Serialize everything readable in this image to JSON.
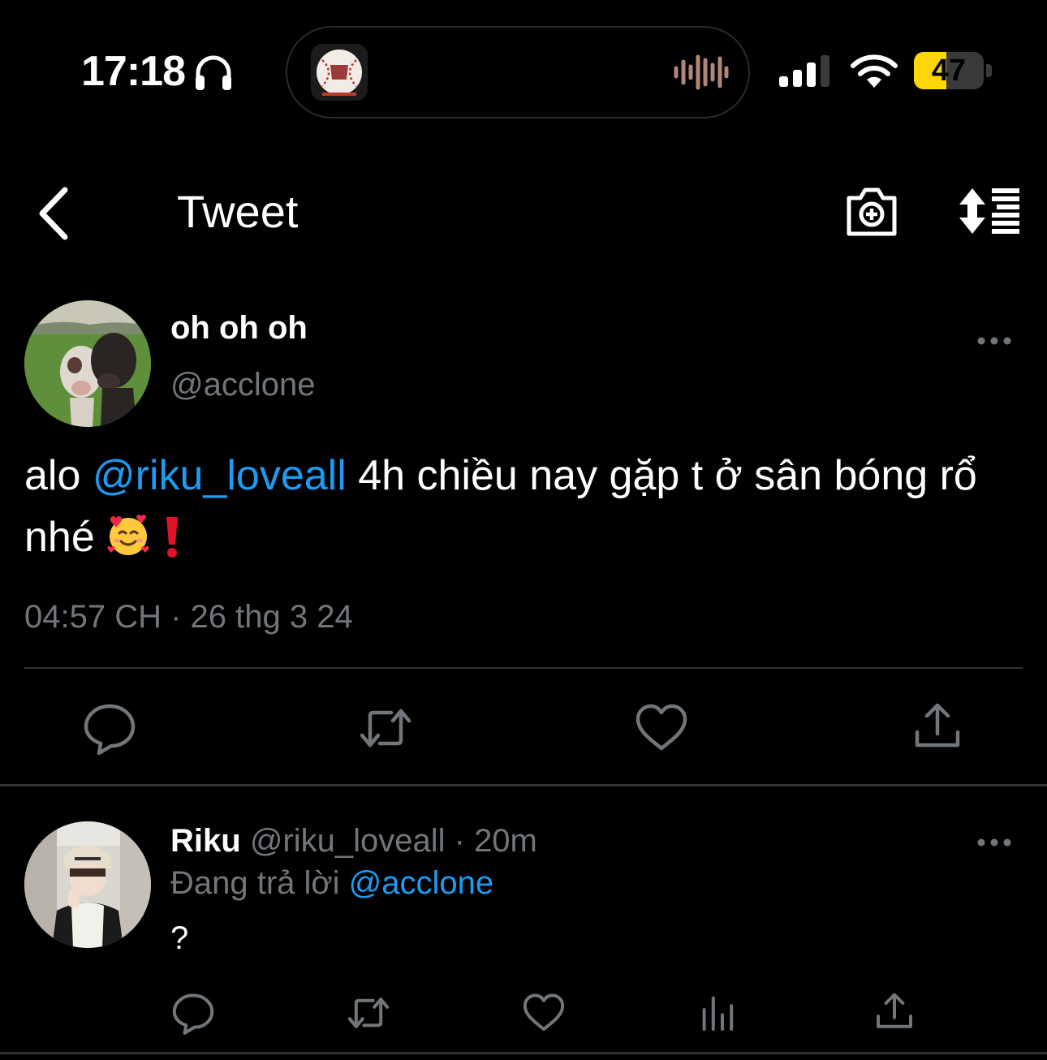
{
  "status_bar": {
    "time": "17:18",
    "battery": "47",
    "battery_level": 0.47,
    "colors": {
      "battery_fill": "#ffd60a"
    }
  },
  "nav": {
    "title": "Tweet",
    "icons": [
      "back-chevron-icon",
      "camera-plus-icon",
      "sort-icon"
    ]
  },
  "tweet": {
    "author_name": "oh oh oh",
    "author_handle": "@acclone",
    "text_before": "alo ",
    "mention": "@riku_loveall",
    "text_after": " 4h chiều nay gặp t ở sân bóng rổ nhé ",
    "timestamp": "04:57 CH · 26 thg 3 24",
    "actions": [
      "reply-icon",
      "retweet-icon",
      "like-icon",
      "share-icon"
    ]
  },
  "reply": {
    "name": "Riku",
    "handle": "@riku_loveall",
    "separator": " · ",
    "time": "20m",
    "replying_to_prefix": "Đang trả lời ",
    "replying_to_handle": "@acclone",
    "text": "?",
    "actions": [
      "reply-icon",
      "retweet-icon",
      "like-icon",
      "views-icon",
      "share-icon"
    ]
  },
  "colors": {
    "background": "#000000",
    "text": "#e7e9ea",
    "secondary": "#71767b",
    "link": "#1d9bf0",
    "divider": "#2f3336"
  }
}
